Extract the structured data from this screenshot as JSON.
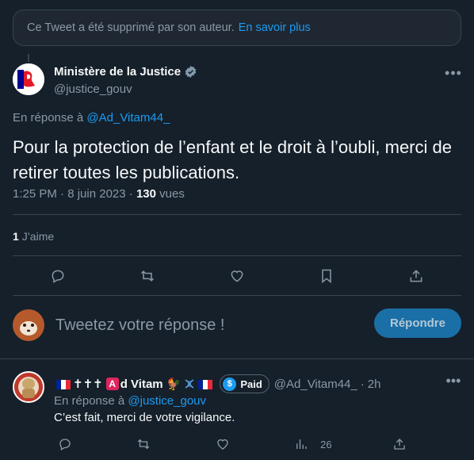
{
  "banner": {
    "text": "Ce Tweet a été supprimé par son auteur.",
    "link": "En savoir plus"
  },
  "tweet": {
    "author_name": "Ministère de la Justice",
    "author_handle": "@justice_gouv",
    "reply_prefix": "En réponse à",
    "reply_handle": "@Ad_Vitam44_",
    "text": "Pour la protection de l’enfant et le droit à l’oubli, merci de retirer toutes les publications.",
    "time": "1:25 PM",
    "date": "8 juin 2023",
    "views_count": "130",
    "views_label": "vues",
    "likes_count": "1",
    "likes_label": "J’aime"
  },
  "compose": {
    "placeholder": "Tweetez votre réponse !",
    "button_label": "Répondre"
  },
  "reply": {
    "name_text_1": "✝✝✝",
    "name_badge": "A",
    "name_text_2": "d Vitam",
    "name_emoji": "🐓",
    "paid_label": "Paid",
    "handle": "@Ad_Vitam44_",
    "time": "2h",
    "reply_prefix": "En réponse à",
    "reply_handle": "@justice_gouv",
    "text": "C’est fait, merci de votre vigilance.",
    "views_count": "26"
  },
  "colors": {
    "background": "#15202b",
    "accent": "#1d9bf0",
    "muted": "#8b98a5",
    "border": "#38444d"
  }
}
